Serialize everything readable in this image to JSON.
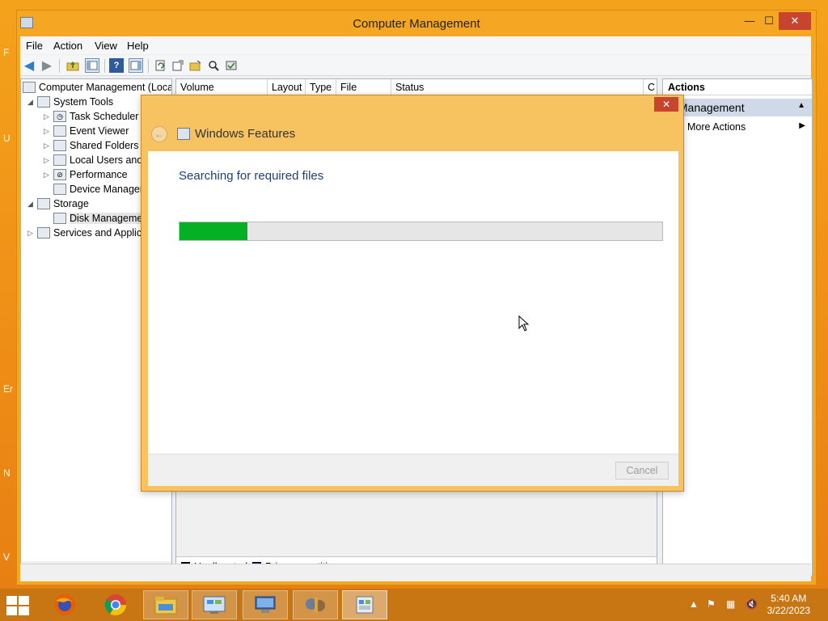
{
  "window": {
    "title": "Computer Management",
    "minimize_glyph": "—",
    "maximize_glyph": "☐",
    "close_glyph": "✕"
  },
  "menu": [
    "File",
    "Action",
    "View",
    "Help"
  ],
  "tree": {
    "root": "Computer Management (Local",
    "items": [
      {
        "label": "System Tools",
        "icon": "tools-icon"
      },
      {
        "label": "Task Scheduler",
        "icon": "clock-icon"
      },
      {
        "label": "Event Viewer",
        "icon": "event-viewer-icon"
      },
      {
        "label": "Shared Folders",
        "icon": "shared-folder-icon"
      },
      {
        "label": "Local Users and G",
        "icon": "users-icon"
      },
      {
        "label": "Performance",
        "icon": "performance-icon"
      },
      {
        "label": "Device Manager",
        "icon": "device-manager-icon"
      },
      {
        "label": "Storage",
        "icon": "storage-icon"
      },
      {
        "label": "Disk Managemen",
        "icon": "disk-icon"
      },
      {
        "label": "Services and Applica",
        "icon": "services-icon"
      }
    ]
  },
  "columns": [
    "Volume",
    "Layout",
    "Type",
    "File System",
    "Status",
    "C"
  ],
  "legend": {
    "unallocated": "Unallocated",
    "primary": "Primary partition",
    "unallocated_color": "#000000",
    "primary_color": "#1a1a8a"
  },
  "actions": {
    "header": "Actions",
    "section": "k Management",
    "more": "More Actions"
  },
  "dialog": {
    "title": "Windows Features",
    "message": "Searching for required files",
    "progress_percent": 14,
    "progress_color": "#06b025",
    "cancel": "Cancel"
  },
  "desktop_edge": [
    "F",
    "U",
    "Er",
    "N",
    "V"
  ],
  "taskbar": {
    "apps": [
      "firefox-icon",
      "chrome-icon",
      "file-explorer-icon",
      "control-panel-icon",
      "remote-desktop-icon",
      "admin-tools-icon",
      "windows-features-icon"
    ],
    "time": "5:40 AM",
    "date": "3/22/2023"
  }
}
